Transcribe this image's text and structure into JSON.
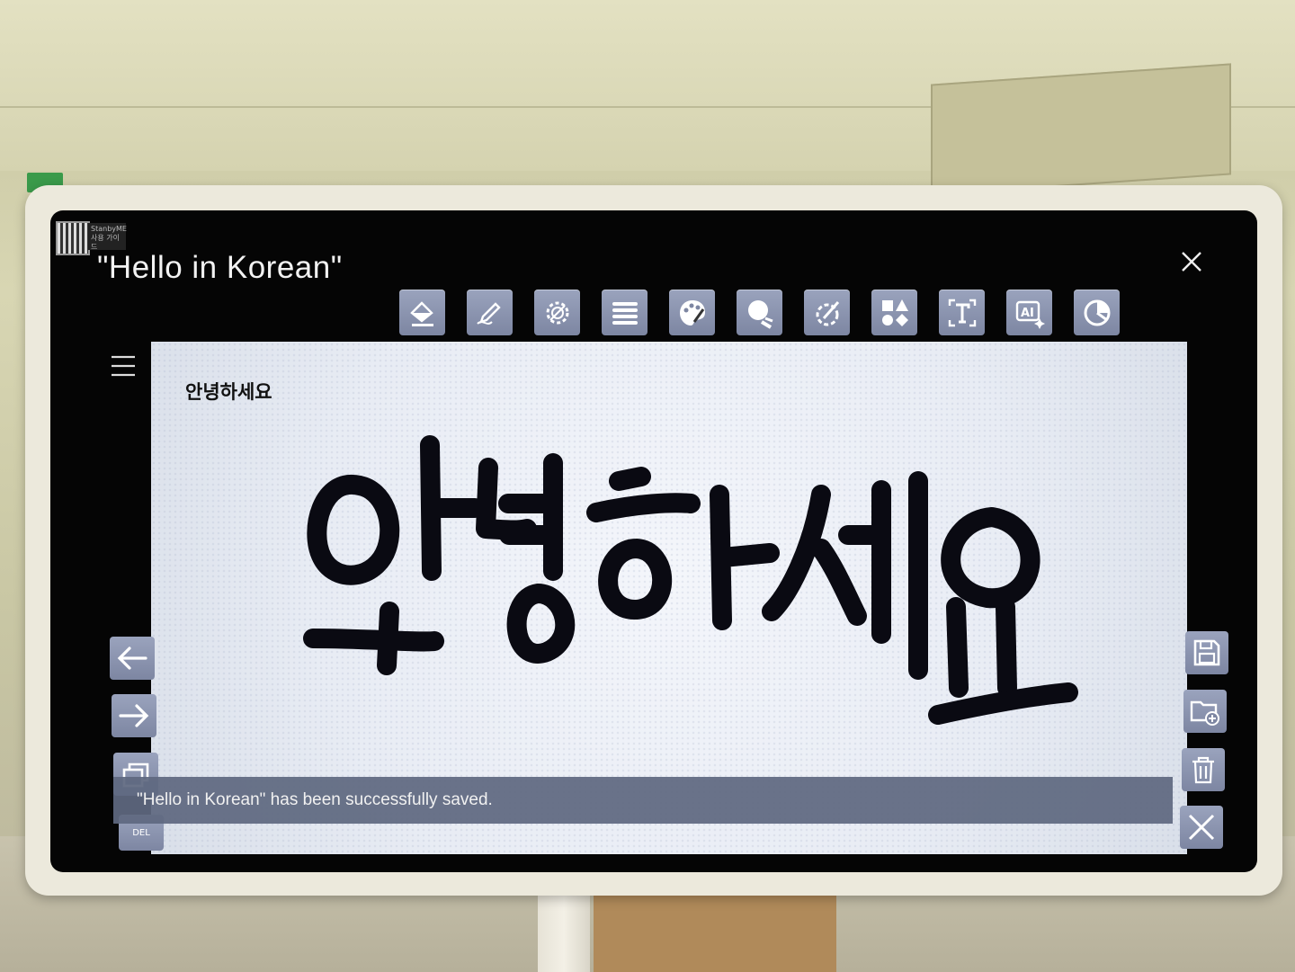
{
  "document": {
    "title": "\"Hello in Korean\"",
    "brand_label": "StanbyME 사용 가이드"
  },
  "canvas": {
    "text_label": "안녕하세요",
    "handwriting": "안녕하세요"
  },
  "toolbar": {
    "tools": [
      {
        "icon": "fill-bucket-icon"
      },
      {
        "icon": "pen-icon"
      },
      {
        "icon": "gear-pattern-icon"
      },
      {
        "icon": "lines-icon"
      },
      {
        "icon": "palette-icon"
      },
      {
        "icon": "sphere-icon"
      },
      {
        "icon": "brush-wheel-icon"
      },
      {
        "icon": "shapes-icon"
      },
      {
        "icon": "text-box-icon"
      },
      {
        "icon": "ai-icon"
      },
      {
        "icon": "pie-chart-icon"
      }
    ]
  },
  "side_left": {
    "undo_icon": "arrow-left-icon",
    "redo_icon": "arrow-right-icon",
    "copy_icon": "copy-icon",
    "delete_label": "DEL"
  },
  "side_right": {
    "save_icon": "save-icon",
    "folder_icon": "folder-add-icon",
    "trash_icon": "trash-icon",
    "close_icon": "close-icon"
  },
  "toast": {
    "message": "\"Hello in Korean\" has been successfully saved."
  },
  "colors": {
    "tool_bg": "#8891ad",
    "toast_bg": "#5f6880",
    "ink": "#0a0a12"
  }
}
